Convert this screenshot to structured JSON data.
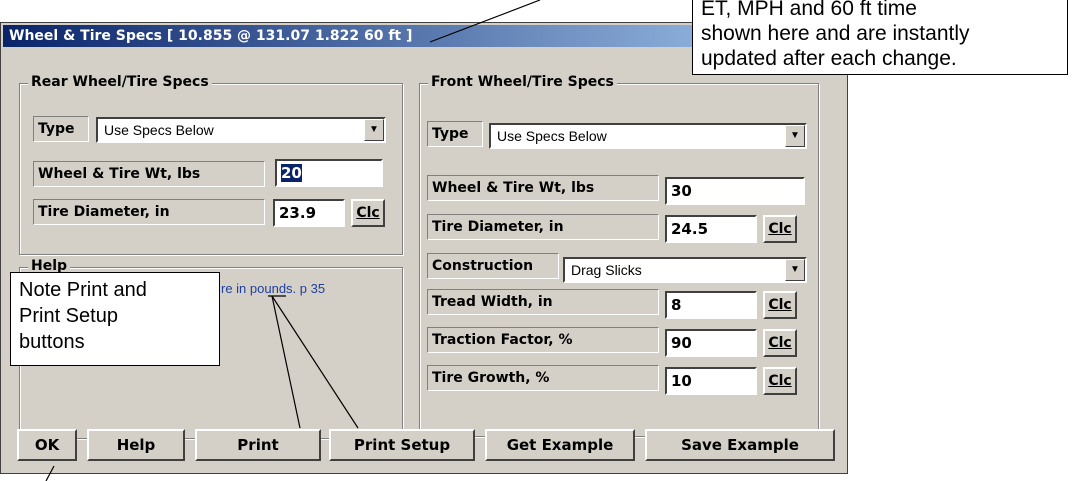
{
  "window": {
    "title": "Wheel & Tire Specs   [ 10.855 @ 131.07   1.822 60 ft ]"
  },
  "rear": {
    "group_title": "Rear Wheel/Tire Specs",
    "type_label": "Type",
    "type_value": "Use Specs Below",
    "wt_label": "Wheel & Tire Wt, lbs",
    "wt_value": "20",
    "dia_label": "Tire Diameter, in",
    "dia_value": "23.9",
    "clc_label": "Clc"
  },
  "help": {
    "group_title": "Help",
    "text": "re in pounds.  p 35"
  },
  "front": {
    "group_title": "Front Wheel/Tire Specs",
    "type_label": "Type",
    "type_value": "Use Specs Below",
    "wt_label": "Wheel & Tire Wt, lbs",
    "wt_value": "30",
    "dia_label": "Tire Diameter, in",
    "dia_value": "24.5",
    "construction_label": "Construction",
    "construction_value": "Drag Slicks",
    "tread_label": "Tread Width, in",
    "tread_value": "8",
    "traction_label": "Traction Factor, %",
    "traction_value": "90",
    "growth_label": "Tire Growth, %",
    "growth_value": "10",
    "clc_label": "Clc"
  },
  "buttons": {
    "ok": "OK",
    "help": "Help",
    "print": "Print",
    "print_setup": "Print Setup",
    "get_example": "Get Example",
    "save_example": "Save Example"
  },
  "callouts": {
    "top_right_line1": "ET, MPH and 60 ft time",
    "top_right_line2": "shown here and are instantly",
    "top_right_line3": "updated after each change.",
    "print_note_line1": "Note Print and",
    "print_note_line2": "Print Setup",
    "print_note_line3": "buttons"
  },
  "icons": {
    "dropdown": "chevron-down-icon"
  }
}
